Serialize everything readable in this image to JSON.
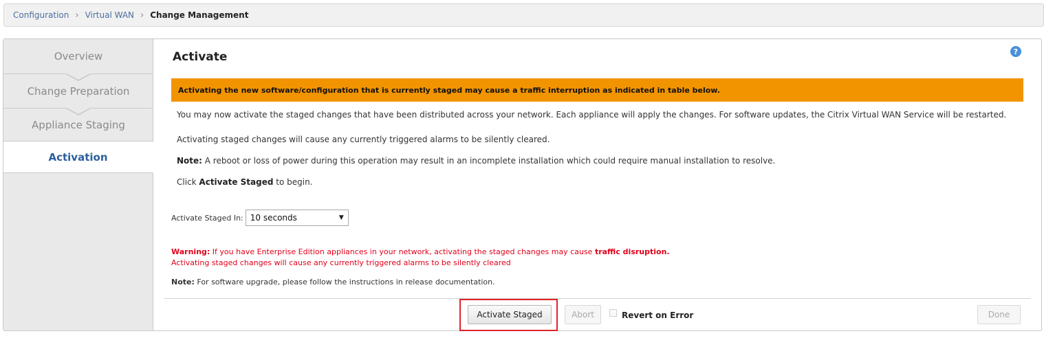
{
  "breadcrumb": {
    "items": [
      "Configuration",
      "Virtual WAN"
    ],
    "current": "Change Management"
  },
  "sidebar": {
    "steps": [
      {
        "label": "Overview",
        "active": false
      },
      {
        "label": "Change Preparation",
        "active": false
      },
      {
        "label": "Appliance Staging",
        "active": false
      },
      {
        "label": "Activation",
        "active": true
      }
    ]
  },
  "main": {
    "title": "Activate",
    "help_icon": "?",
    "banner": "Activating the new software/configuration that is currently staged may cause a traffic interruption as indicated in table below.",
    "para1": "You may now activate the staged changes that have been distributed across your network. Each appliance will apply the changes. For software updates, the Citrix Virtual WAN Service will be restarted.",
    "para2": "Activating staged changes will cause any currently triggered alarms to be silently cleared.",
    "note_label": "Note:",
    "note_text": " A reboot or loss of power during this operation may result in an incomplete installation which could require manual installation to resolve.",
    "click_prefix": "Click ",
    "click_bold": "Activate Staged",
    "click_suffix": " to begin.",
    "select_label": "Activate Staged In:",
    "select_value": "10 seconds",
    "warning_label": "Warning:",
    "warning_text": " If you have Enterprise Edition appliances in your network, activating the staged changes may cause ",
    "warning_bold": "traffic disruption.",
    "warning_line2": "Activating staged changes will cause any currently triggered alarms to be silently cleared",
    "note2_label": "Note:",
    "note2_text": " For software upgrade, please follow the instructions in release documentation."
  },
  "footer": {
    "activate_label": "Activate Staged",
    "abort_label": "Abort",
    "revert_label": "Revert on Error",
    "revert_checked": false,
    "done_label": "Done"
  },
  "colors": {
    "banner": "#f29400",
    "warning": "#e0001a",
    "active_step": "#2c5f9e",
    "highlight": "#e0242b"
  }
}
